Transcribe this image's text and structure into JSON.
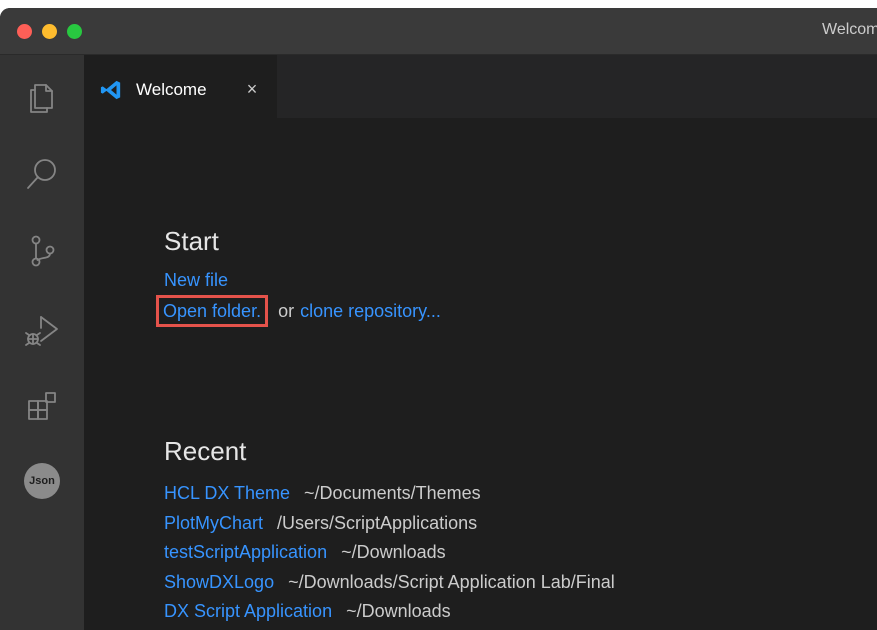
{
  "window": {
    "title": "Welcome"
  },
  "activity_bar": {
    "items": [
      {
        "icon": "explorer-icon"
      },
      {
        "icon": "search-icon"
      },
      {
        "icon": "source-control-icon"
      },
      {
        "icon": "run-debug-icon"
      },
      {
        "icon": "extensions-icon"
      },
      {
        "icon": "json-icon",
        "label": "Json"
      }
    ]
  },
  "tabs": [
    {
      "label": "Welcome",
      "icon": "vscode-logo-icon",
      "close": "×"
    }
  ],
  "start": {
    "heading": "Start",
    "new_file": "New file",
    "open_folder": "Open folder.",
    "or_text": "or",
    "clone_repository": "clone repository..."
  },
  "recent": {
    "heading": "Recent",
    "items": [
      {
        "name": "HCL DX Theme",
        "path": "~/Documents/Themes"
      },
      {
        "name": "PlotMyChart",
        "path": "/Users/ScriptApplications"
      },
      {
        "name": "testScriptApplication",
        "path": "~/Downloads"
      },
      {
        "name": "ShowDXLogo",
        "path": "~/Downloads/Script Application Lab/Final"
      },
      {
        "name": "DX Script Application",
        "path": "~/Downloads"
      }
    ]
  },
  "colors": {
    "link": "#3794ff",
    "highlight_box": "#e5534b",
    "editor_background": "#1e1e1e",
    "activity_bar_background": "#333333"
  }
}
